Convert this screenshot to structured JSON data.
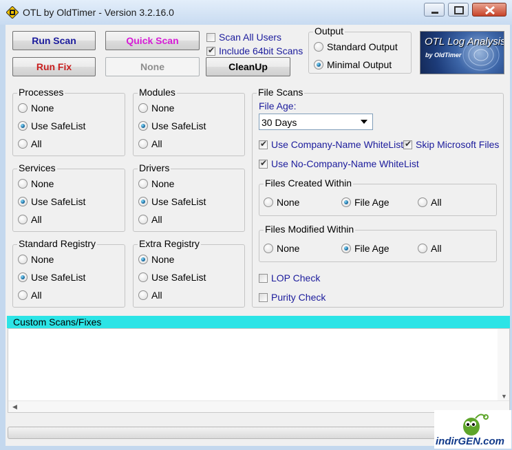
{
  "window": {
    "title": "OTL by OldTimer - Version 3.2.16.0"
  },
  "toolbar": {
    "run_scan": "Run Scan",
    "quick_scan": "Quick Scan",
    "run_fix": "Run Fix",
    "none": "None",
    "cleanup": "CleanUp",
    "scan_all_users": "Scan All Users",
    "include_64bit": "Include 64bit Scans",
    "colors": {
      "run_scan": "#1a1a9c",
      "quick_scan": "#d61bd6",
      "run_fix": "#c81e1e"
    }
  },
  "output": {
    "label": "Output",
    "standard": "Standard Output",
    "minimal": "Minimal Output",
    "selected": "minimal"
  },
  "logo": {
    "title": "OTL Log Analysis",
    "subtitle": "by OldTimer"
  },
  "groups": {
    "processes": {
      "label": "Processes",
      "opts": [
        "None",
        "Use SafeList",
        "All"
      ],
      "selected": 1
    },
    "modules": {
      "label": "Modules",
      "opts": [
        "None",
        "Use SafeList",
        "All"
      ],
      "selected": 1
    },
    "services": {
      "label": "Services",
      "opts": [
        "None",
        "Use SafeList",
        "All"
      ],
      "selected": 1
    },
    "drivers": {
      "label": "Drivers",
      "opts": [
        "None",
        "Use SafeList",
        "All"
      ],
      "selected": 1
    },
    "std_registry": {
      "label": "Standard Registry",
      "opts": [
        "None",
        "Use SafeList",
        "All"
      ],
      "selected": 1
    },
    "extra_registry": {
      "label": "Extra Registry",
      "opts": [
        "None",
        "Use SafeList",
        "All"
      ],
      "selected": 0
    }
  },
  "file_scans": {
    "label": "File Scans",
    "file_age_label": "File Age:",
    "file_age_value": "30 Days",
    "company_whitelist": "Use Company-Name WhiteList",
    "skip_ms": "Skip Microsoft Files",
    "no_company_whitelist": "Use No-Company-Name WhiteList",
    "created": {
      "label": "Files Created Within",
      "opts": [
        "None",
        "File Age",
        "All"
      ],
      "selected": 1
    },
    "modified": {
      "label": "Files Modified Within",
      "opts": [
        "None",
        "File Age",
        "All"
      ],
      "selected": 1
    },
    "lop_check": "LOP Check",
    "purity_check": "Purity Check"
  },
  "custom": {
    "label": "Custom Scans/Fixes",
    "text": ""
  },
  "watermark": {
    "text": "indirGEN.com"
  }
}
